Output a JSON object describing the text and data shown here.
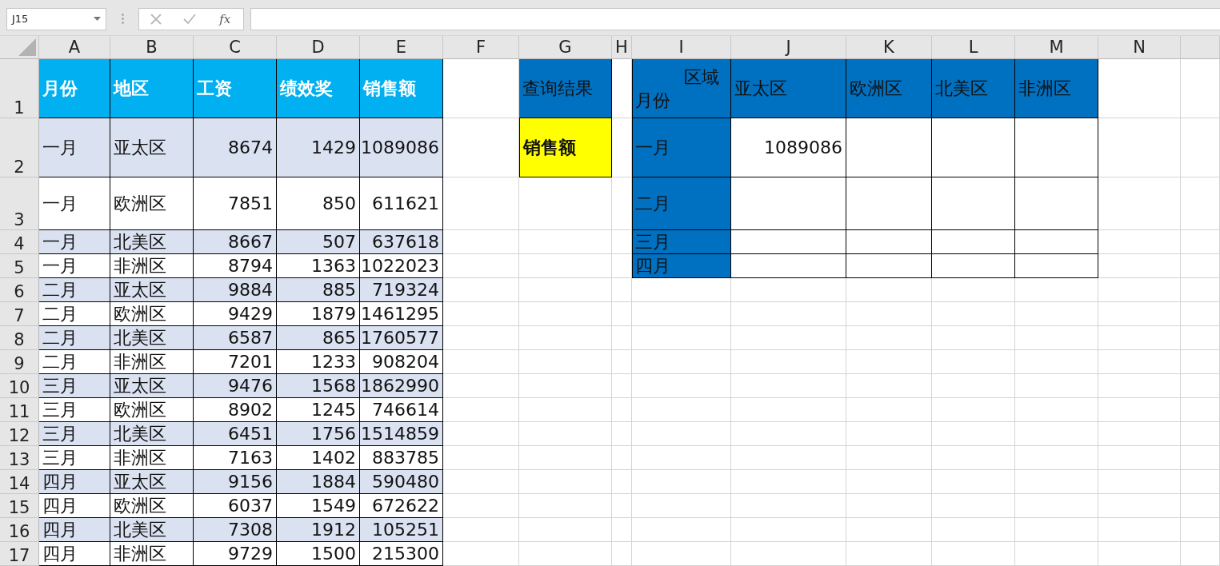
{
  "name_box": {
    "value": "J15"
  },
  "formula_bar": {
    "function_label": "fx"
  },
  "column_headers": [
    "A",
    "B",
    "C",
    "D",
    "E",
    "F",
    "G",
    "H",
    "I",
    "J",
    "K",
    "L",
    "M",
    "N"
  ],
  "row_headers": [
    "1",
    "2",
    "3",
    "4",
    "5",
    "6",
    "7",
    "8",
    "9",
    "10",
    "11",
    "12",
    "13",
    "14",
    "15",
    "16",
    "17"
  ],
  "source_table": {
    "columns": [
      "月份",
      "地区",
      "工资",
      "绩效奖",
      "销售额"
    ],
    "rows": [
      [
        "一月",
        "亚太区",
        "8674",
        "1429",
        "1089086"
      ],
      [
        "一月",
        "欧洲区",
        "7851",
        "850",
        "611621"
      ],
      [
        "一月",
        "北美区",
        "8667",
        "507",
        "637618"
      ],
      [
        "一月",
        "非洲区",
        "8794",
        "1363",
        "1022023"
      ],
      [
        "二月",
        "亚太区",
        "9884",
        "885",
        "719324"
      ],
      [
        "二月",
        "欧洲区",
        "9429",
        "1879",
        "1461295"
      ],
      [
        "二月",
        "北美区",
        "6587",
        "865",
        "1760577"
      ],
      [
        "二月",
        "非洲区",
        "7201",
        "1233",
        "908204"
      ],
      [
        "三月",
        "亚太区",
        "9476",
        "1568",
        "1862990"
      ],
      [
        "三月",
        "欧洲区",
        "8902",
        "1245",
        "746614"
      ],
      [
        "三月",
        "北美区",
        "6451",
        "1756",
        "1514859"
      ],
      [
        "三月",
        "非洲区",
        "7163",
        "1402",
        "883785"
      ],
      [
        "四月",
        "亚太区",
        "9156",
        "1884",
        "590480"
      ],
      [
        "四月",
        "欧洲区",
        "6037",
        "1549",
        "672622"
      ],
      [
        "四月",
        "北美区",
        "7308",
        "1912",
        "105251"
      ],
      [
        "四月",
        "非洲区",
        "9729",
        "1500",
        "215300"
      ]
    ]
  },
  "query": {
    "title": "查询结果",
    "field": "销售额"
  },
  "matrix": {
    "corner_top": "区域",
    "corner_bottom": "月份",
    "columns": [
      "亚太区",
      "欧洲区",
      "北美区",
      "非洲区"
    ],
    "rows": [
      {
        "label": "一月",
        "cells": [
          "1089086"
        ]
      },
      {
        "label": "二月"
      },
      {
        "label": "三月"
      },
      {
        "label": "四月"
      }
    ]
  }
}
